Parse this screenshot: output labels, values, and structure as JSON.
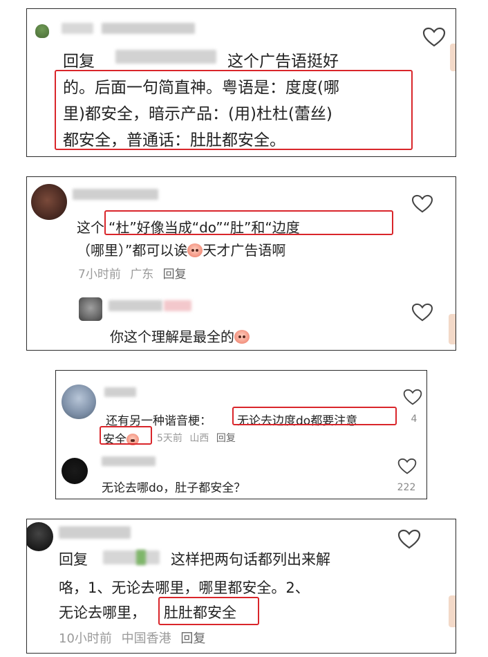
{
  "panel1": {
    "reply_label": "回复",
    "line1_tail": "这个广告语挺好",
    "line2": "的。后面一句简直神。粤语是：度度(哪",
    "line3": "里)都安全，暗示产品：(用)杜杜(蕾丝)",
    "line4": "都安全，普通话：肚肚都安全。"
  },
  "panel2": {
    "line1_prefix": "这个",
    "line1_highlight": "“杜”好像当成“do”“肚”和“边度",
    "line2_a": "（哪里）”都可以诶",
    "line2_b": "天才广告语啊",
    "meta_time": "7小时前",
    "meta_loc": "广东",
    "meta_reply": "回复",
    "sub_text": "你这个理解是最全的"
  },
  "panel3": {
    "c1_prefix": "还有另一种谐音梗：",
    "c1_highlight": "无论去边度do都要注意",
    "c1_line2_highlight": "安全",
    "c1_meta_time": "5天前",
    "c1_meta_loc": "山西",
    "c1_meta_reply": "回复",
    "c1_likes": "4",
    "c2_text": "无论去哪do，肚子都安全？",
    "c2_likes": "222"
  },
  "panel4": {
    "reply_label": "回复",
    "line1_tail": "这样把两句话都列出来解",
    "line2": "咯，1、无论去哪里，哪里都安全。2、",
    "line3_prefix": "无论去哪里，",
    "line3_highlight": "肚肚都安全",
    "meta_time": "10小时前",
    "meta_loc": "中国香港",
    "meta_reply": "回复"
  },
  "icons": [
    "heart-icon",
    "broccoli-avatar-icon",
    "smiley-emoji-icon",
    "side-tab-icon"
  ],
  "colors": {
    "highlight": "#d9252a",
    "meta": "#9a9a9a",
    "text": "#222222"
  }
}
